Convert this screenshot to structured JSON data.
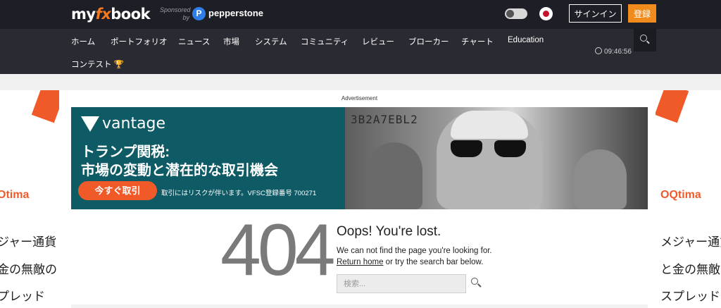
{
  "header": {
    "logo_pre": "my",
    "logo_fx": "fx",
    "logo_post": "book",
    "sponsored_line1": "Sponsored",
    "sponsored_line2": "by",
    "sponsor_name": "pepperstone",
    "signin_label": "サインイン",
    "register_label": "登録"
  },
  "nav": {
    "items": [
      "ホーム",
      "ポートフォリオ",
      "ニュース",
      "市場",
      "システム",
      "コミュニティ",
      "レビュー",
      "ブローカー",
      "チャート",
      "Education"
    ],
    "contest_label": "コンテスト 🏆",
    "time": "09:46:56"
  },
  "ad": {
    "label": "Advertisement",
    "brand": "vantage",
    "headline_1": "トランプ関税:",
    "headline_2": "市場の変動と潜在的な取引機会",
    "cta": "今すぐ取引",
    "disclaimer": "取引にはリスクが伴います。VFSC登録番号 700271",
    "serial": "3B2A7EBL2"
  },
  "side_ad": {
    "brand_left": "Otima",
    "brand_right": "OQtima",
    "lines_left": [
      "ジャー通貨",
      "金の無敵の",
      "プレッド"
    ],
    "lines_right": [
      "メジャー通貨",
      "と金の無敵",
      "スプレッド"
    ]
  },
  "error": {
    "code": "404",
    "title": "Oops! You're lost.",
    "message": "We can not find the page you're looking for.",
    "return_link": "Return home",
    "suffix": " or try the search bar below.",
    "search_placeholder": "検索..."
  },
  "colors": {
    "accent": "#f18b1c",
    "header_bg": "#1e1e26",
    "nav_bg": "#2a2a33",
    "ad_teal": "#0e5b66",
    "ad_orange": "#f05a28"
  }
}
